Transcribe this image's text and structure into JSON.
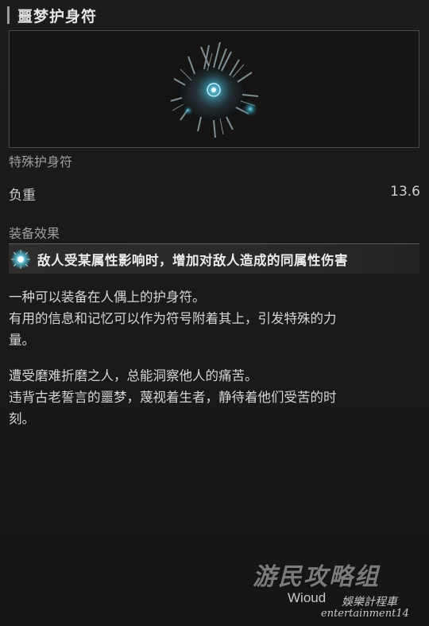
{
  "item": {
    "name": "噩梦护身符",
    "category": "特殊护身符",
    "weight_label": "负重",
    "weight_value": "13.6",
    "image_icon": "nightmare-amulet-icon"
  },
  "effects": {
    "section_label": "装备效果",
    "items": [
      {
        "icon": "effect-orb-icon",
        "text": "敌人受某属性影响时，增加对敌人造成的同属性伤害"
      }
    ]
  },
  "description": {
    "paragraph1": [
      "一种可以装备在人偶上的护身符。",
      "有用的信息和记忆可以作为符号附着其上，引发特殊的力",
      "量。"
    ],
    "paragraph2": [
      "遭受磨难折磨之人，总能洞察他人的痛苦。",
      "违背古老誓言的噩梦，蔑视着生者，静待着他们受苦的时",
      "刻。"
    ]
  },
  "watermark": {
    "main": "游民攻略组",
    "sub_left": "Wioud",
    "sub_right": "娛樂計程車",
    "sub_bottom": "entertainment14"
  },
  "colors": {
    "background": "#1b1a19",
    "accent_glow": "#5fd0e8",
    "text": "#d6d6d6",
    "muted": "#9e9e9e"
  }
}
